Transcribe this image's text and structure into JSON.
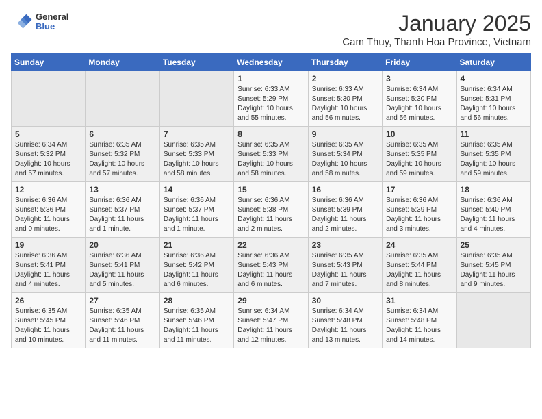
{
  "logo": {
    "general": "General",
    "blue": "Blue"
  },
  "header": {
    "title": "January 2025",
    "subtitle": "Cam Thuy, Thanh Hoa Province, Vietnam"
  },
  "weekdays": [
    "Sunday",
    "Monday",
    "Tuesday",
    "Wednesday",
    "Thursday",
    "Friday",
    "Saturday"
  ],
  "weeks": [
    [
      {
        "day": "",
        "sunrise": "",
        "sunset": "",
        "daylight": ""
      },
      {
        "day": "",
        "sunrise": "",
        "sunset": "",
        "daylight": ""
      },
      {
        "day": "",
        "sunrise": "",
        "sunset": "",
        "daylight": ""
      },
      {
        "day": "1",
        "sunrise": "Sunrise: 6:33 AM",
        "sunset": "Sunset: 5:29 PM",
        "daylight": "Daylight: 10 hours and 55 minutes."
      },
      {
        "day": "2",
        "sunrise": "Sunrise: 6:33 AM",
        "sunset": "Sunset: 5:30 PM",
        "daylight": "Daylight: 10 hours and 56 minutes."
      },
      {
        "day": "3",
        "sunrise": "Sunrise: 6:34 AM",
        "sunset": "Sunset: 5:30 PM",
        "daylight": "Daylight: 10 hours and 56 minutes."
      },
      {
        "day": "4",
        "sunrise": "Sunrise: 6:34 AM",
        "sunset": "Sunset: 5:31 PM",
        "daylight": "Daylight: 10 hours and 56 minutes."
      }
    ],
    [
      {
        "day": "5",
        "sunrise": "Sunrise: 6:34 AM",
        "sunset": "Sunset: 5:32 PM",
        "daylight": "Daylight: 10 hours and 57 minutes."
      },
      {
        "day": "6",
        "sunrise": "Sunrise: 6:35 AM",
        "sunset": "Sunset: 5:32 PM",
        "daylight": "Daylight: 10 hours and 57 minutes."
      },
      {
        "day": "7",
        "sunrise": "Sunrise: 6:35 AM",
        "sunset": "Sunset: 5:33 PM",
        "daylight": "Daylight: 10 hours and 58 minutes."
      },
      {
        "day": "8",
        "sunrise": "Sunrise: 6:35 AM",
        "sunset": "Sunset: 5:33 PM",
        "daylight": "Daylight: 10 hours and 58 minutes."
      },
      {
        "day": "9",
        "sunrise": "Sunrise: 6:35 AM",
        "sunset": "Sunset: 5:34 PM",
        "daylight": "Daylight: 10 hours and 58 minutes."
      },
      {
        "day": "10",
        "sunrise": "Sunrise: 6:35 AM",
        "sunset": "Sunset: 5:35 PM",
        "daylight": "Daylight: 10 hours and 59 minutes."
      },
      {
        "day": "11",
        "sunrise": "Sunrise: 6:35 AM",
        "sunset": "Sunset: 5:35 PM",
        "daylight": "Daylight: 10 hours and 59 minutes."
      }
    ],
    [
      {
        "day": "12",
        "sunrise": "Sunrise: 6:36 AM",
        "sunset": "Sunset: 5:36 PM",
        "daylight": "Daylight: 11 hours and 0 minutes."
      },
      {
        "day": "13",
        "sunrise": "Sunrise: 6:36 AM",
        "sunset": "Sunset: 5:37 PM",
        "daylight": "Daylight: 11 hours and 1 minute."
      },
      {
        "day": "14",
        "sunrise": "Sunrise: 6:36 AM",
        "sunset": "Sunset: 5:37 PM",
        "daylight": "Daylight: 11 hours and 1 minute."
      },
      {
        "day": "15",
        "sunrise": "Sunrise: 6:36 AM",
        "sunset": "Sunset: 5:38 PM",
        "daylight": "Daylight: 11 hours and 2 minutes."
      },
      {
        "day": "16",
        "sunrise": "Sunrise: 6:36 AM",
        "sunset": "Sunset: 5:39 PM",
        "daylight": "Daylight: 11 hours and 2 minutes."
      },
      {
        "day": "17",
        "sunrise": "Sunrise: 6:36 AM",
        "sunset": "Sunset: 5:39 PM",
        "daylight": "Daylight: 11 hours and 3 minutes."
      },
      {
        "day": "18",
        "sunrise": "Sunrise: 6:36 AM",
        "sunset": "Sunset: 5:40 PM",
        "daylight": "Daylight: 11 hours and 4 minutes."
      }
    ],
    [
      {
        "day": "19",
        "sunrise": "Sunrise: 6:36 AM",
        "sunset": "Sunset: 5:41 PM",
        "daylight": "Daylight: 11 hours and 4 minutes."
      },
      {
        "day": "20",
        "sunrise": "Sunrise: 6:36 AM",
        "sunset": "Sunset: 5:41 PM",
        "daylight": "Daylight: 11 hours and 5 minutes."
      },
      {
        "day": "21",
        "sunrise": "Sunrise: 6:36 AM",
        "sunset": "Sunset: 5:42 PM",
        "daylight": "Daylight: 11 hours and 6 minutes."
      },
      {
        "day": "22",
        "sunrise": "Sunrise: 6:36 AM",
        "sunset": "Sunset: 5:43 PM",
        "daylight": "Daylight: 11 hours and 6 minutes."
      },
      {
        "day": "23",
        "sunrise": "Sunrise: 6:35 AM",
        "sunset": "Sunset: 5:43 PM",
        "daylight": "Daylight: 11 hours and 7 minutes."
      },
      {
        "day": "24",
        "sunrise": "Sunrise: 6:35 AM",
        "sunset": "Sunset: 5:44 PM",
        "daylight": "Daylight: 11 hours and 8 minutes."
      },
      {
        "day": "25",
        "sunrise": "Sunrise: 6:35 AM",
        "sunset": "Sunset: 5:45 PM",
        "daylight": "Daylight: 11 hours and 9 minutes."
      }
    ],
    [
      {
        "day": "26",
        "sunrise": "Sunrise: 6:35 AM",
        "sunset": "Sunset: 5:45 PM",
        "daylight": "Daylight: 11 hours and 10 minutes."
      },
      {
        "day": "27",
        "sunrise": "Sunrise: 6:35 AM",
        "sunset": "Sunset: 5:46 PM",
        "daylight": "Daylight: 11 hours and 11 minutes."
      },
      {
        "day": "28",
        "sunrise": "Sunrise: 6:35 AM",
        "sunset": "Sunset: 5:46 PM",
        "daylight": "Daylight: 11 hours and 11 minutes."
      },
      {
        "day": "29",
        "sunrise": "Sunrise: 6:34 AM",
        "sunset": "Sunset: 5:47 PM",
        "daylight": "Daylight: 11 hours and 12 minutes."
      },
      {
        "day": "30",
        "sunrise": "Sunrise: 6:34 AM",
        "sunset": "Sunset: 5:48 PM",
        "daylight": "Daylight: 11 hours and 13 minutes."
      },
      {
        "day": "31",
        "sunrise": "Sunrise: 6:34 AM",
        "sunset": "Sunset: 5:48 PM",
        "daylight": "Daylight: 11 hours and 14 minutes."
      },
      {
        "day": "",
        "sunrise": "",
        "sunset": "",
        "daylight": ""
      }
    ]
  ]
}
